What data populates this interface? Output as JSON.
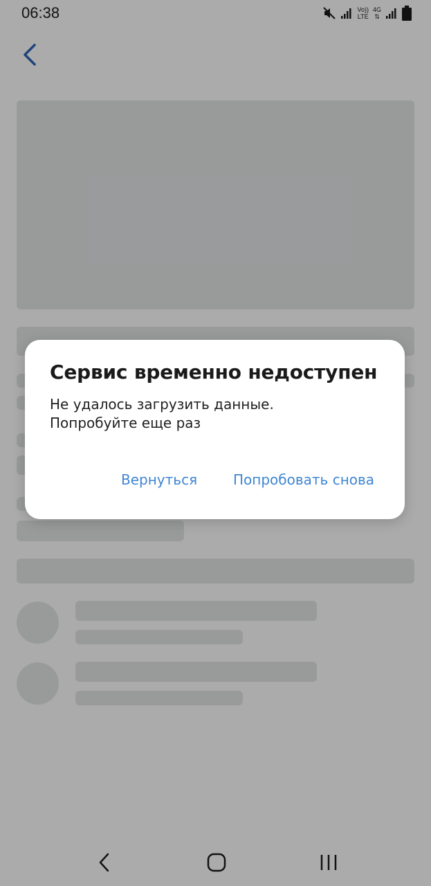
{
  "status_bar": {
    "time": "06:38",
    "network_label_top": "Vo))",
    "network_label_bottom": "LTE",
    "network_type": "4G",
    "icons": [
      "mute-icon",
      "signal-icon",
      "volte-icon",
      "network-4g-icon",
      "signal-icon",
      "battery-icon"
    ]
  },
  "header": {
    "back_icon": "chevron-left-icon"
  },
  "dialog": {
    "title": "Сервис временно недоступен",
    "message_line1": "Не удалось загрузить данные.",
    "message_line2": "Попробуйте еще раз",
    "back_label": "Вернуться",
    "retry_label": "Попробовать снова",
    "accent_color": "#3f86d3"
  },
  "nav_bar": {
    "icons": [
      "nav-back-icon",
      "nav-home-icon",
      "nav-recents-icon"
    ]
  },
  "colors": {
    "skeleton": "#e4e7e8",
    "back_arrow": "#2e66b8"
  }
}
